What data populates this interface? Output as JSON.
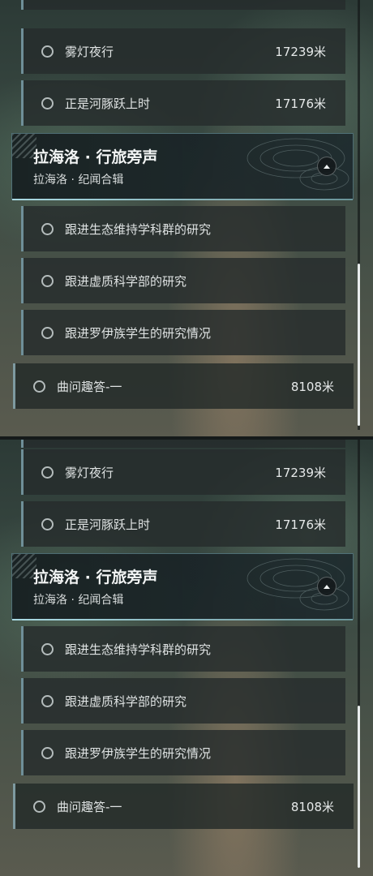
{
  "top_panel": {
    "items": [
      {
        "label": "雾灯夜行",
        "distance": "17239米"
      },
      {
        "label": "正是河豚跃上时",
        "distance": "17176米"
      }
    ],
    "group": {
      "title": "拉海洛 · 行旅旁声",
      "subtitle": "拉海洛 · 纪闻合辑",
      "tasks": [
        {
          "label": "跟进生态维持学科群的研究"
        },
        {
          "label": "跟进虚质科学部的研究"
        },
        {
          "label": "跟进罗伊族学生的研究情况"
        }
      ]
    },
    "outer_item": {
      "label": "曲问趣答-一",
      "distance": "8108米"
    }
  },
  "bottom_panel": {
    "items": [
      {
        "label": "雾灯夜行",
        "distance": "17239米"
      },
      {
        "label": "正是河豚跃上时",
        "distance": "17176米"
      }
    ],
    "group": {
      "title": "拉海洛 · 行旅旁声",
      "subtitle": "拉海洛 · 纪闻合辑",
      "tasks": [
        {
          "label": "跟进生态维持学科群的研究"
        },
        {
          "label": "跟进虚质科学部的研究"
        },
        {
          "label": "跟进罗伊族学生的研究情况"
        }
      ]
    },
    "outer_item": {
      "label": "曲问趣答-一",
      "distance": "8108米"
    }
  },
  "icons": {
    "radio": "radio-circle-icon",
    "collapse": "chevron-up-icon"
  }
}
